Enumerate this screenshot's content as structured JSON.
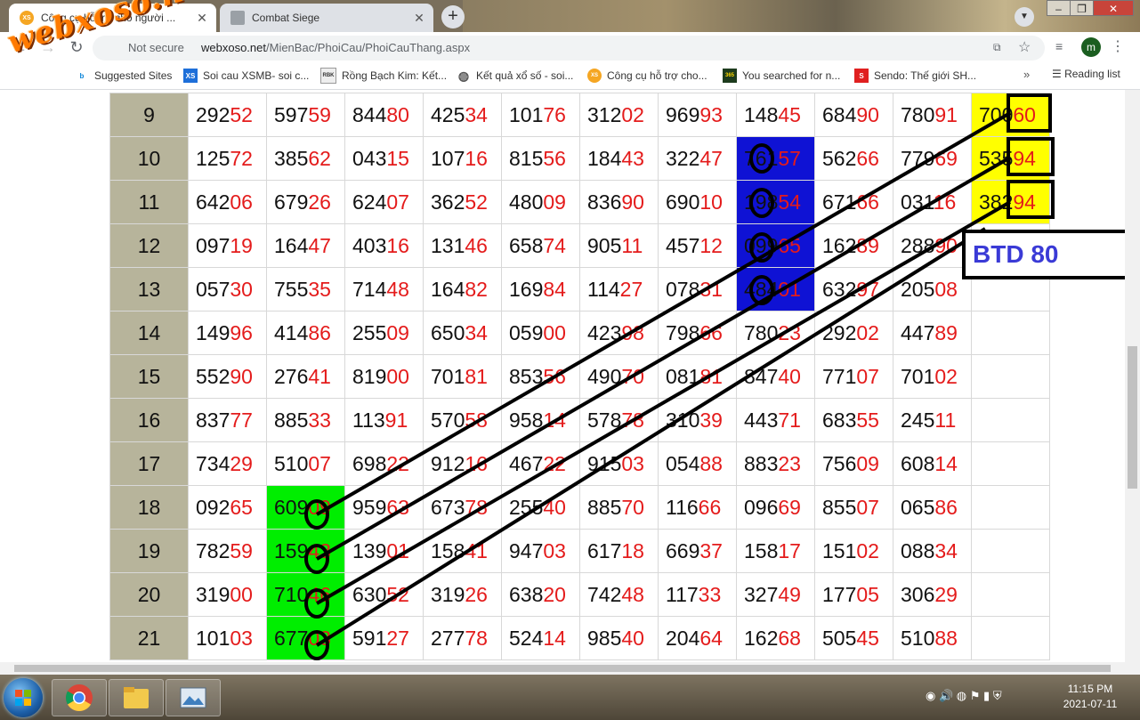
{
  "browser": {
    "tabs": [
      {
        "title": "Công cụ hỗ trợ cho người ...",
        "favicon": "XS",
        "active": true
      },
      {
        "title": "Combat Siege",
        "favicon": "",
        "active": false
      }
    ],
    "address": {
      "security": "Not secure",
      "host": "webxoso.net",
      "path": "/MienBac/PhoiCau/PhoiCauThang.aspx"
    },
    "profile_initial": "m",
    "bookmarks": [
      {
        "label": "Suggested Sites",
        "icon": "bing-icon"
      },
      {
        "label": "Soi cau XSMB- soi c...",
        "icon": "xs-icon"
      },
      {
        "label": "Rồng Bạch Kim: Kết...",
        "icon": "rbk-icon"
      },
      {
        "label": "Kết quả xổ số - soi...",
        "icon": "globe-icon"
      },
      {
        "label": "Công cụ hỗ trợ cho...",
        "icon": "xs-icon"
      },
      {
        "label": "You searched for n...",
        "icon": "365-icon"
      },
      {
        "label": "Sendo: Thế giới SH...",
        "icon": "sendo-icon"
      }
    ],
    "reading_list": "Reading list"
  },
  "watermark": "webxoso.net",
  "table": {
    "rows": [
      {
        "n": "9",
        "cells": [
          [
            "292",
            "52"
          ],
          [
            "597",
            "59"
          ],
          [
            "844",
            "80"
          ],
          [
            "425",
            "34"
          ],
          [
            "101",
            "76"
          ],
          [
            "312",
            "02"
          ],
          [
            "969",
            "93"
          ],
          [
            "148",
            "45"
          ],
          [
            "684",
            "90"
          ],
          [
            "780",
            "91"
          ],
          [
            "700",
            "60"
          ]
        ]
      },
      {
        "n": "10",
        "cells": [
          [
            "125",
            "72"
          ],
          [
            "385",
            "62"
          ],
          [
            "043",
            "15"
          ],
          [
            "107",
            "16"
          ],
          [
            "815",
            "56"
          ],
          [
            "184",
            "43"
          ],
          [
            "322",
            "47"
          ],
          [
            "761",
            "57"
          ],
          [
            "562",
            "66"
          ],
          [
            "779",
            "69"
          ],
          [
            "535",
            "94"
          ]
        ]
      },
      {
        "n": "11",
        "cells": [
          [
            "642",
            "06"
          ],
          [
            "679",
            "26"
          ],
          [
            "624",
            "07"
          ],
          [
            "362",
            "52"
          ],
          [
            "480",
            "09"
          ],
          [
            "836",
            "90"
          ],
          [
            "690",
            "10"
          ],
          [
            "198",
            "54"
          ],
          [
            "671",
            "66"
          ],
          [
            "031",
            "16"
          ],
          [
            "382",
            "94"
          ]
        ]
      },
      {
        "n": "12",
        "cells": [
          [
            "097",
            "19"
          ],
          [
            "164",
            "47"
          ],
          [
            "403",
            "16"
          ],
          [
            "131",
            "46"
          ],
          [
            "658",
            "74"
          ],
          [
            "905",
            "11"
          ],
          [
            "457",
            "12"
          ],
          [
            "099",
            "65"
          ],
          [
            "162",
            "89"
          ],
          [
            "288",
            "90"
          ],
          [
            "",
            ""
          ]
        ]
      },
      {
        "n": "13",
        "cells": [
          [
            "057",
            "30"
          ],
          [
            "755",
            "35"
          ],
          [
            "714",
            "48"
          ],
          [
            "164",
            "82"
          ],
          [
            "169",
            "84"
          ],
          [
            "114",
            "27"
          ],
          [
            "078",
            "31"
          ],
          [
            "484",
            "01"
          ],
          [
            "632",
            "97"
          ],
          [
            "205",
            "08"
          ],
          [
            "",
            ""
          ]
        ]
      },
      {
        "n": "14",
        "cells": [
          [
            "149",
            "96"
          ],
          [
            "414",
            "86"
          ],
          [
            "255",
            "09"
          ],
          [
            "650",
            "34"
          ],
          [
            "059",
            "00"
          ],
          [
            "423",
            "98"
          ],
          [
            "798",
            "66"
          ],
          [
            "780",
            "23"
          ],
          [
            "292",
            "02"
          ],
          [
            "447",
            "89"
          ],
          [
            "",
            ""
          ]
        ]
      },
      {
        "n": "15",
        "cells": [
          [
            "552",
            "90"
          ],
          [
            "276",
            "41"
          ],
          [
            "819",
            "00"
          ],
          [
            "701",
            "81"
          ],
          [
            "853",
            "56"
          ],
          [
            "490",
            "70"
          ],
          [
            "081",
            "81"
          ],
          [
            "847",
            "40"
          ],
          [
            "771",
            "07"
          ],
          [
            "701",
            "02"
          ],
          [
            "",
            ""
          ]
        ]
      },
      {
        "n": "16",
        "cells": [
          [
            "837",
            "77"
          ],
          [
            "885",
            "33"
          ],
          [
            "113",
            "91"
          ],
          [
            "570",
            "58"
          ],
          [
            "958",
            "14"
          ],
          [
            "578",
            "78"
          ],
          [
            "310",
            "39"
          ],
          [
            "443",
            "71"
          ],
          [
            "683",
            "55"
          ],
          [
            "245",
            "11"
          ],
          [
            "",
            ""
          ]
        ]
      },
      {
        "n": "17",
        "cells": [
          [
            "734",
            "29"
          ],
          [
            "510",
            "07"
          ],
          [
            "698",
            "22"
          ],
          [
            "912",
            "16"
          ],
          [
            "467",
            "22"
          ],
          [
            "915",
            "03"
          ],
          [
            "054",
            "88"
          ],
          [
            "883",
            "23"
          ],
          [
            "756",
            "09"
          ],
          [
            "608",
            "14"
          ],
          [
            "",
            ""
          ]
        ]
      },
      {
        "n": "18",
        "cells": [
          [
            "092",
            "65"
          ],
          [
            "609",
            "09"
          ],
          [
            "959",
            "63"
          ],
          [
            "673",
            "78"
          ],
          [
            "255",
            "40"
          ],
          [
            "885",
            "70"
          ],
          [
            "116",
            "66"
          ],
          [
            "096",
            "69"
          ],
          [
            "855",
            "07"
          ],
          [
            "065",
            "86"
          ],
          [
            "",
            ""
          ]
        ]
      },
      {
        "n": "19",
        "cells": [
          [
            "782",
            "59"
          ],
          [
            "159",
            "43"
          ],
          [
            "139",
            "01"
          ],
          [
            "158",
            "41"
          ],
          [
            "947",
            "03"
          ],
          [
            "617",
            "18"
          ],
          [
            "669",
            "37"
          ],
          [
            "158",
            "17"
          ],
          [
            "151",
            "02"
          ],
          [
            "088",
            "34"
          ],
          [
            "",
            ""
          ]
        ]
      },
      {
        "n": "20",
        "cells": [
          [
            "319",
            "00"
          ],
          [
            "710",
            "46"
          ],
          [
            "630",
            "52"
          ],
          [
            "319",
            "26"
          ],
          [
            "638",
            "20"
          ],
          [
            "742",
            "48"
          ],
          [
            "117",
            "33"
          ],
          [
            "327",
            "49"
          ],
          [
            "177",
            "05"
          ],
          [
            "306",
            "29"
          ],
          [
            "",
            ""
          ]
        ]
      },
      {
        "n": "21",
        "cells": [
          [
            "101",
            "03"
          ],
          [
            "677",
            "03"
          ],
          [
            "591",
            "27"
          ],
          [
            "277",
            "78"
          ],
          [
            "524",
            "14"
          ],
          [
            "985",
            "40"
          ],
          [
            "204",
            "64"
          ],
          [
            "162",
            "68"
          ],
          [
            "505",
            "45"
          ],
          [
            "510",
            "88"
          ],
          [
            "",
            ""
          ]
        ]
      }
    ],
    "highlight_colors": {
      "green": "#00ee00",
      "blue": "#0f12d4",
      "yellow": "#ffff00",
      "tail_digits": "#e41b1b"
    }
  },
  "annotation": {
    "label": "BTD 80"
  },
  "taskbar": {
    "time": "11:15 PM",
    "date": "2021-07-11"
  }
}
